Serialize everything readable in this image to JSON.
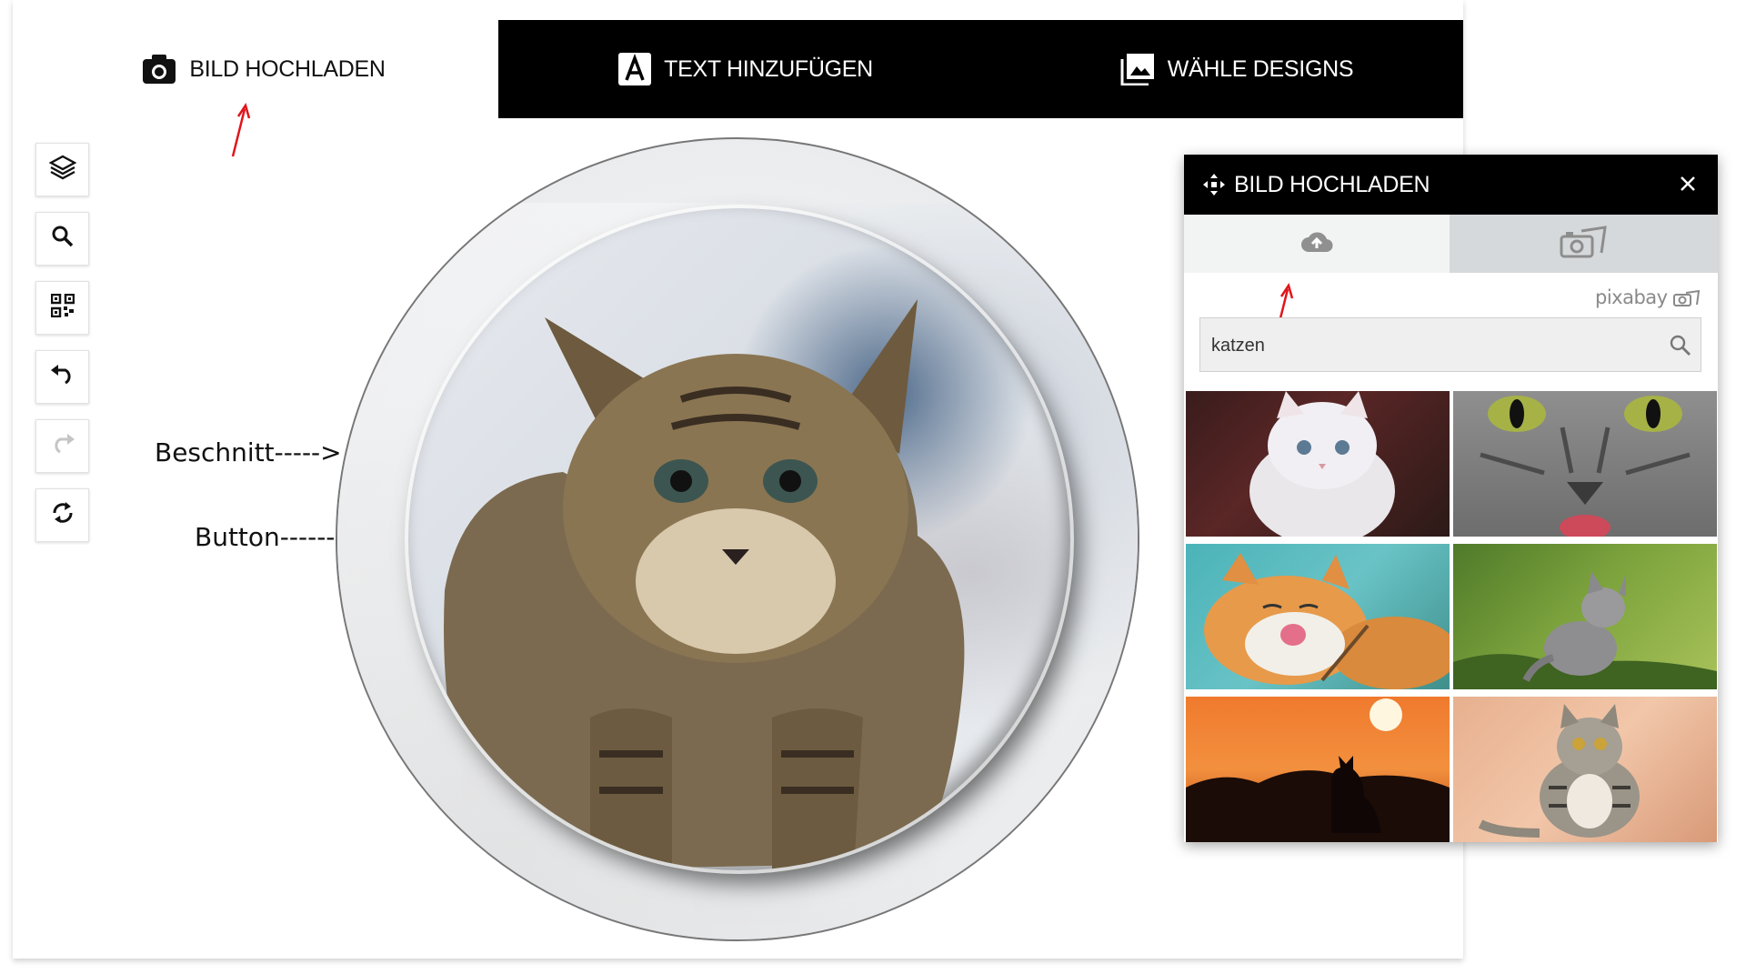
{
  "tabs": {
    "upload_label": "BILD HOCHLADEN",
    "text_label": "TEXT HINZUFÜGEN",
    "designs_label": "WÄHLE DESIGNS"
  },
  "toolbar": {
    "icons": [
      "layers-icon",
      "zoom-icon",
      "qr-code-icon",
      "undo-icon",
      "redo-icon",
      "refresh-icon"
    ]
  },
  "annotations": {
    "crop_label": "Beschnitt----->",
    "button_label": "Button--------->"
  },
  "panel": {
    "title": "BILD HOCHLADEN",
    "tabs": [
      "upload-cloud-icon",
      "pixabay-camera-icon"
    ],
    "brand": "pixabay",
    "search_value": "katzen",
    "results": [
      "white-kitten-thumbnail",
      "grey-cat-closeup-thumbnail",
      "orange-cat-licking-thumbnail",
      "grey-kitten-grass-thumbnail",
      "cat-silhouette-sunset-thumbnail",
      "tabby-cat-sitting-thumbnail"
    ]
  },
  "colors": {
    "tabbar_bg": "#000000",
    "panel_header_bg": "#000000",
    "annotation_arrow": "#e0151b",
    "active_tab_bg": "#d6d9db"
  }
}
